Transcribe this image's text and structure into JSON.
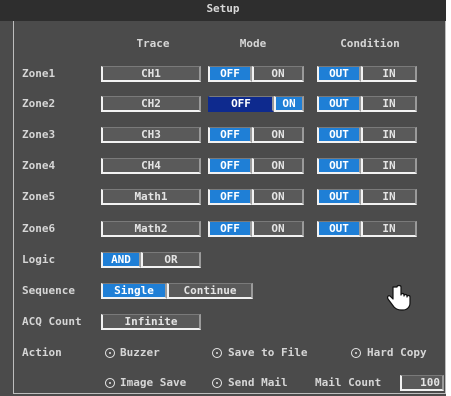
{
  "title": "Setup",
  "headers": {
    "trace": "Trace",
    "mode": "Mode",
    "condition": "Condition"
  },
  "zones": [
    {
      "label": "Zone1",
      "trace": "CH1",
      "off": "OFF",
      "on": "ON",
      "out": "OUT",
      "in": "IN"
    },
    {
      "label": "Zone2",
      "trace": "CH2",
      "off": "OFF",
      "on": "ON",
      "out": "OUT",
      "in": "IN"
    },
    {
      "label": "Zone3",
      "trace": "CH3",
      "off": "OFF",
      "on": "ON",
      "out": "OUT",
      "in": "IN"
    },
    {
      "label": "Zone4",
      "trace": "CH4",
      "off": "OFF",
      "on": "ON",
      "out": "OUT",
      "in": "IN"
    },
    {
      "label": "Zone5",
      "trace": "Math1",
      "off": "OFF",
      "on": "ON",
      "out": "OUT",
      "in": "IN"
    },
    {
      "label": "Zone6",
      "trace": "Math2",
      "off": "OFF",
      "on": "ON",
      "out": "OUT",
      "in": "IN"
    }
  ],
  "logic": {
    "label": "Logic",
    "and": "AND",
    "or": "OR"
  },
  "sequence": {
    "label": "Sequence",
    "single": "Single",
    "continue": "Continue"
  },
  "acq": {
    "label": "ACQ Count",
    "value": "Infinite"
  },
  "action": {
    "label": "Action",
    "buzzer": "Buzzer",
    "save_to_file": "Save to File",
    "hard_copy": "Hard Copy",
    "image_save": "Image Save",
    "send_mail": "Send Mail",
    "mail_count_label": "Mail Count",
    "mail_count_value": "100"
  },
  "colors": {
    "selected": "#1f7fd6",
    "selected_dark": "#0e2a8e",
    "panel": "#4b4b4b"
  }
}
